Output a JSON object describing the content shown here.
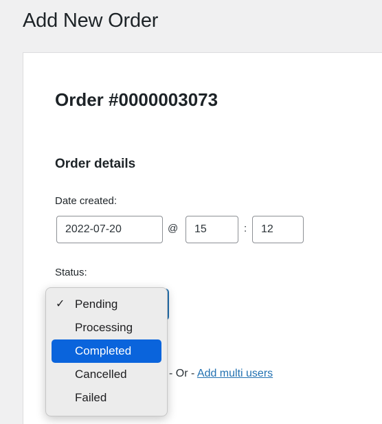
{
  "page": {
    "title": "Add New Order"
  },
  "order": {
    "heading": "Order #0000003073"
  },
  "details": {
    "heading": "Order details",
    "date_label": "Date created:",
    "date_value": "2022-07-20",
    "at_sep": "@",
    "hour_value": "15",
    "colon_sep": ":",
    "minute_value": "12",
    "status_label": "Status:"
  },
  "status_dropdown": {
    "selected": "Pending",
    "check_mark": "✓",
    "options": [
      "Pending",
      "Processing",
      "Completed",
      "Cancelled",
      "Failed"
    ],
    "highlighted": "Completed",
    "highlight_color": "#0a64dc"
  },
  "customer": {
    "or_text": "- Or -",
    "link_text": "Add multi users",
    "link_color": "#2271b1"
  }
}
